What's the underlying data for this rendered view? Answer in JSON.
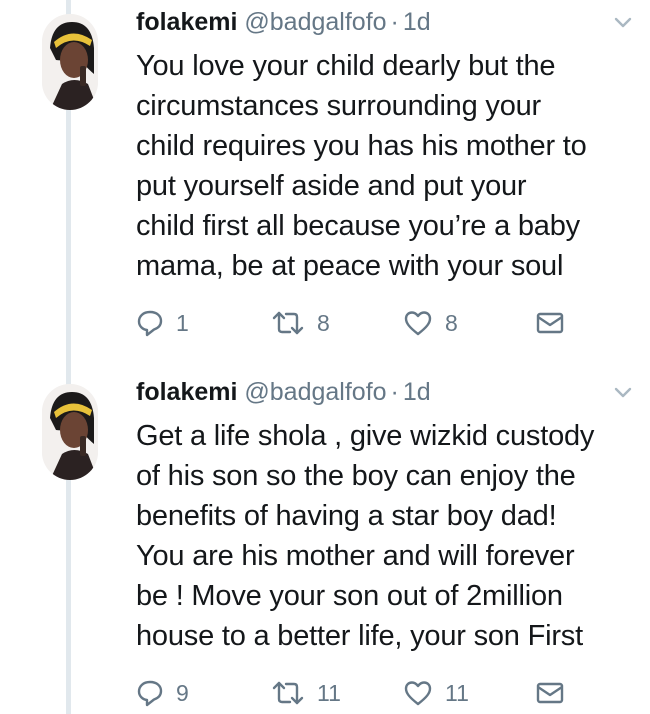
{
  "tweets": [
    {
      "name": "folakemi",
      "handle": "@badgalfofo",
      "separator": "·",
      "time": "1d",
      "text": "You love your child dearly but the\ncircumstances surrounding your\nchild requires you has his mother to\nput yourself aside and put your\nchild first all because you’re a baby\nmama, be at peace with your soul",
      "replies": "1",
      "retweets": "8",
      "likes": "8"
    },
    {
      "name": "folakemi",
      "handle": "@badgalfofo",
      "separator": "·",
      "time": "1d",
      "text": "Get a life shola , give wizkid custody\nof his son so the boy can enjoy the\nbenefits of having a star boy dad!\nYou are his mother and will forever\nbe ! Move your son out of 2million\nhouse to a better life, your son First",
      "replies": "9",
      "retweets": "11",
      "likes": "11"
    }
  ],
  "icons": {
    "reply": "reply-icon",
    "retweet": "retweet-icon",
    "like": "heart-icon",
    "message": "envelope-icon",
    "menu": "chevron-down-icon"
  },
  "colors": {
    "text": "#14171a",
    "secondary": "#657786",
    "thread_line": "#e1e8ed"
  }
}
